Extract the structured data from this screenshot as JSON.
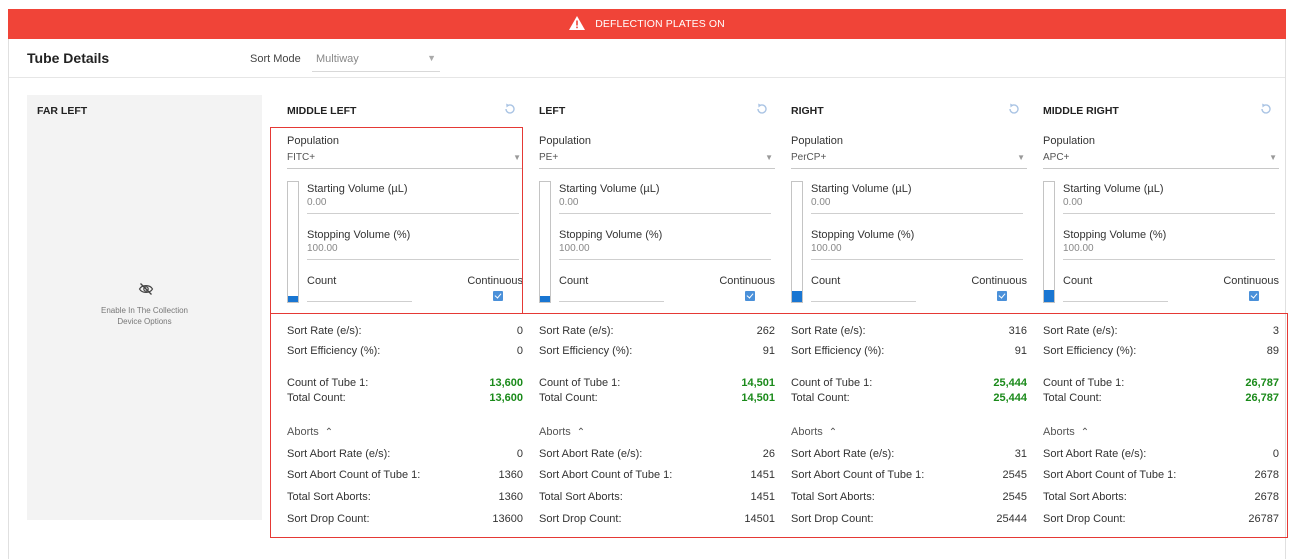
{
  "banner": {
    "text": "DEFLECTION PLATES ON",
    "color": "#f04438"
  },
  "header": {
    "title": "Tube Details",
    "sort_mode_label": "Sort Mode",
    "sort_mode_value": "Multiway"
  },
  "far_left": {
    "title": "FAR LEFT",
    "icon": "eye-off-icon",
    "message_line1": "Enable In The Collection",
    "message_line2": "Device Options"
  },
  "labels": {
    "population": "Population",
    "starting_volume": "Starting Volume (µL)",
    "stopping_volume": "Stopping Volume (%)",
    "count": "Count",
    "continuous": "Continuous",
    "sort_rate": "Sort Rate (e/s):",
    "sort_efficiency": "Sort Efficiency (%):",
    "count_of_tube": "Count of Tube 1:",
    "total_count": "Total Count:",
    "aborts": "Aborts",
    "sort_abort_rate": "Sort Abort Rate (e/s):",
    "sort_abort_count": "Sort Abort Count of Tube 1:",
    "total_sort_aborts": "Total Sort Aborts:",
    "sort_drop_count": "Sort Drop Count:"
  },
  "columns": [
    {
      "title": "MIDDLE LEFT",
      "population": "FITC+",
      "starting_volume": "0.00",
      "stopping_volume": "100.00",
      "count": "",
      "continuous": true,
      "volume_level": 0.05,
      "sort_rate": "0",
      "sort_efficiency": "0",
      "count_of_tube": "13,600",
      "total_count": "13,600",
      "sort_abort_rate": "0",
      "sort_abort_count": "1360",
      "total_sort_aborts": "1360",
      "sort_drop_count": "13600"
    },
    {
      "title": "LEFT",
      "population": "PE+",
      "starting_volume": "0.00",
      "stopping_volume": "100.00",
      "count": "",
      "continuous": true,
      "volume_level": 0.05,
      "sort_rate": "262",
      "sort_efficiency": "91",
      "count_of_tube": "14,501",
      "total_count": "14,501",
      "sort_abort_rate": "26",
      "sort_abort_count": "1451",
      "total_sort_aborts": "1451",
      "sort_drop_count": "14501"
    },
    {
      "title": "RIGHT",
      "population": "PerCP+",
      "starting_volume": "0.00",
      "stopping_volume": "100.00",
      "count": "",
      "continuous": true,
      "volume_level": 0.09,
      "sort_rate": "316",
      "sort_efficiency": "91",
      "count_of_tube": "25,444",
      "total_count": "25,444",
      "sort_abort_rate": "31",
      "sort_abort_count": "2545",
      "total_sort_aborts": "2545",
      "sort_drop_count": "25444"
    },
    {
      "title": "MIDDLE RIGHT",
      "population": "APC+",
      "starting_volume": "0.00",
      "stopping_volume": "100.00",
      "count": "",
      "continuous": true,
      "volume_level": 0.1,
      "sort_rate": "3",
      "sort_efficiency": "89",
      "count_of_tube": "26,787",
      "total_count": "26,787",
      "sort_abort_rate": "0",
      "sort_abort_count": "2678",
      "total_sort_aborts": "2678",
      "sort_drop_count": "26787"
    }
  ]
}
